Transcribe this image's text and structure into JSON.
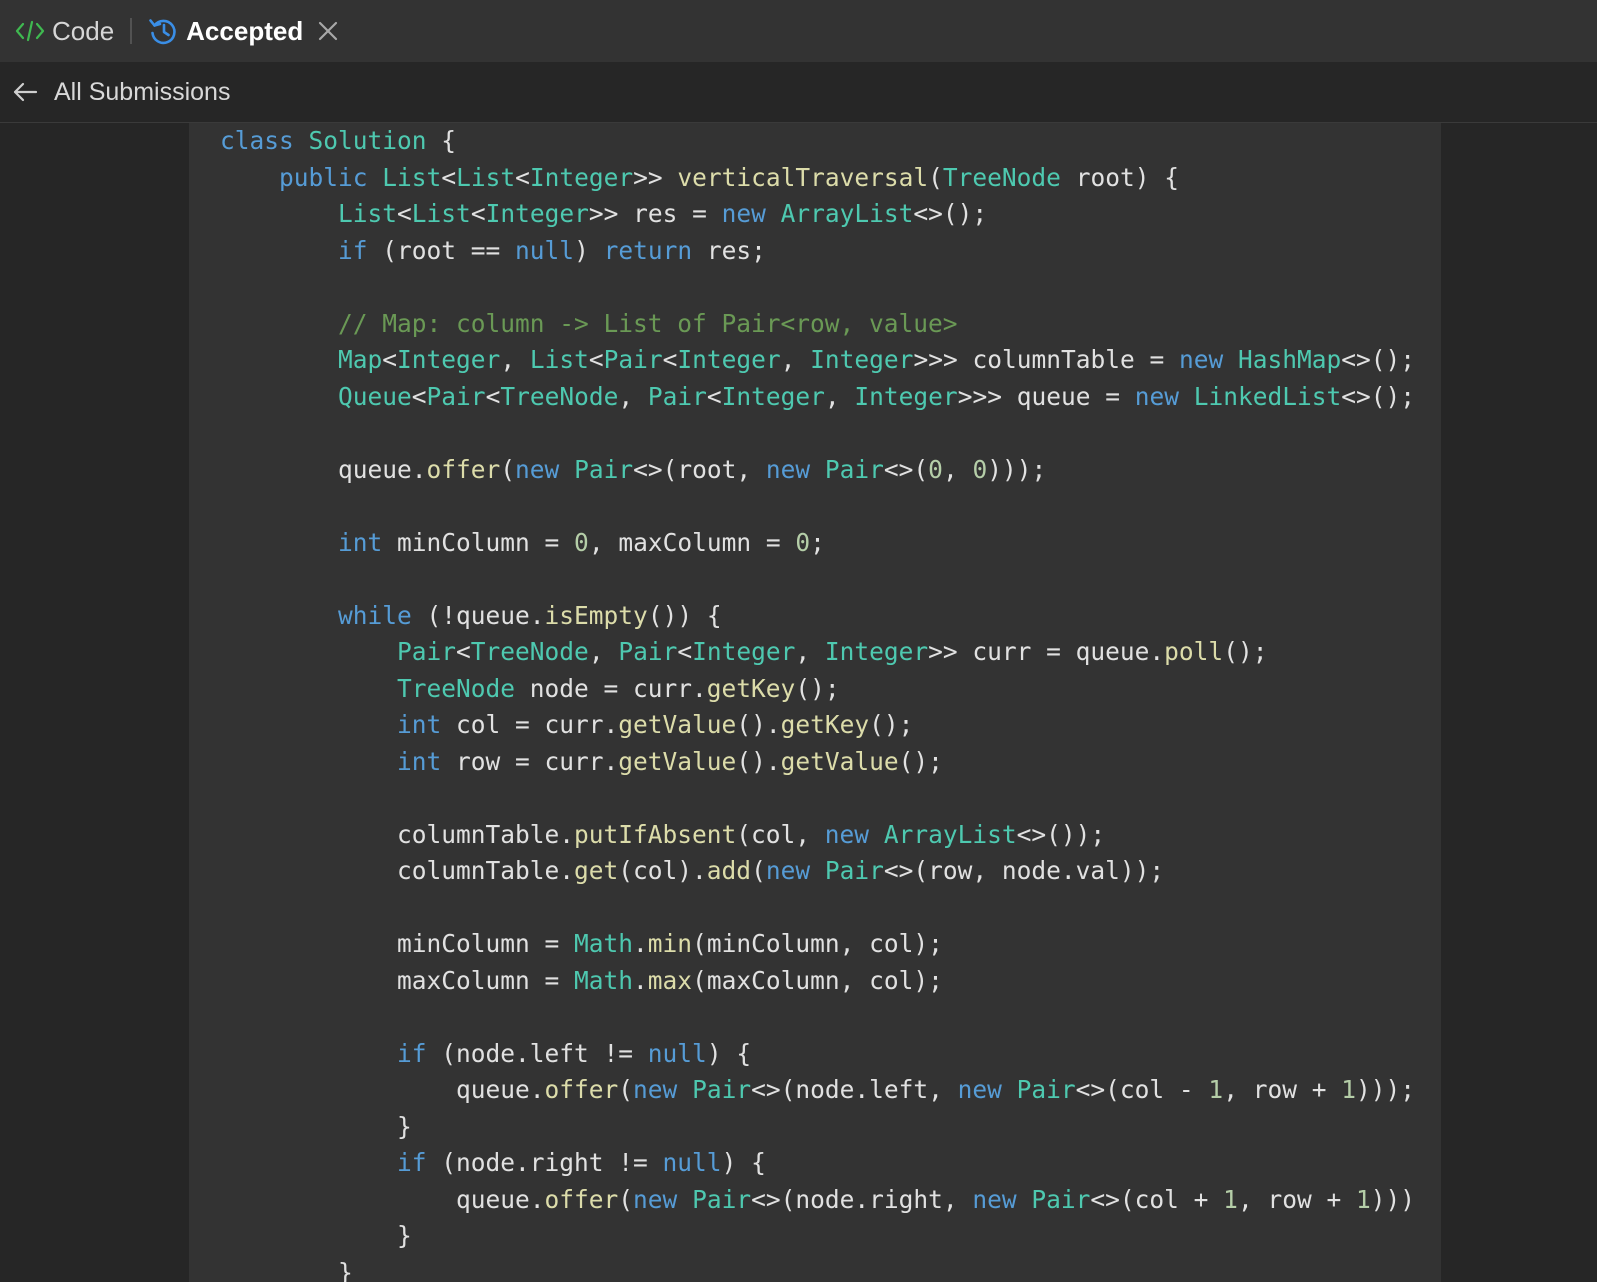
{
  "tabs": {
    "code_label": "Code",
    "accepted_label": "Accepted"
  },
  "subheader": {
    "back_label": "All Submissions"
  },
  "colors": {
    "code_icon": "#3fb950",
    "accepted_icon": "#3a8ee6",
    "keyword": "#569cd6",
    "type": "#4ec9b0",
    "function": "#dcdcaa",
    "number": "#b5cea8",
    "comment": "#6a9955"
  },
  "icons": [
    "code-brackets-icon",
    "history-icon",
    "close-icon",
    "arrow-left-icon"
  ],
  "code_lines": [
    "class Solution {",
    "    public List<List<Integer>> verticalTraversal(TreeNode root) {",
    "        List<List<Integer>> res = new ArrayList<>();",
    "        if (root == null) return res;",
    "",
    "        // Map: column -> List of Pair<row, value>",
    "        Map<Integer, List<Pair<Integer, Integer>>> columnTable = new HashMap<>();",
    "        Queue<Pair<TreeNode, Pair<Integer, Integer>>> queue = new LinkedList<>();",
    "",
    "        queue.offer(new Pair<>(root, new Pair<>(0, 0)));",
    "",
    "        int minColumn = 0, maxColumn = 0;",
    "",
    "        while (!queue.isEmpty()) {",
    "            Pair<TreeNode, Pair<Integer, Integer>> curr = queue.poll();",
    "            TreeNode node = curr.getKey();",
    "            int col = curr.getValue().getKey();",
    "            int row = curr.getValue().getValue();",
    "",
    "            columnTable.putIfAbsent(col, new ArrayList<>());",
    "            columnTable.get(col).add(new Pair<>(row, node.val));",
    "",
    "            minColumn = Math.min(minColumn, col);",
    "            maxColumn = Math.max(maxColumn, col);",
    "",
    "            if (node.left != null) {",
    "                queue.offer(new Pair<>(node.left, new Pair<>(col - 1, row + 1)));",
    "            }",
    "            if (node.right != null) {",
    "                queue.offer(new Pair<>(node.right, new Pair<>(col + 1, row + 1)))",
    "            }",
    "        }"
  ]
}
